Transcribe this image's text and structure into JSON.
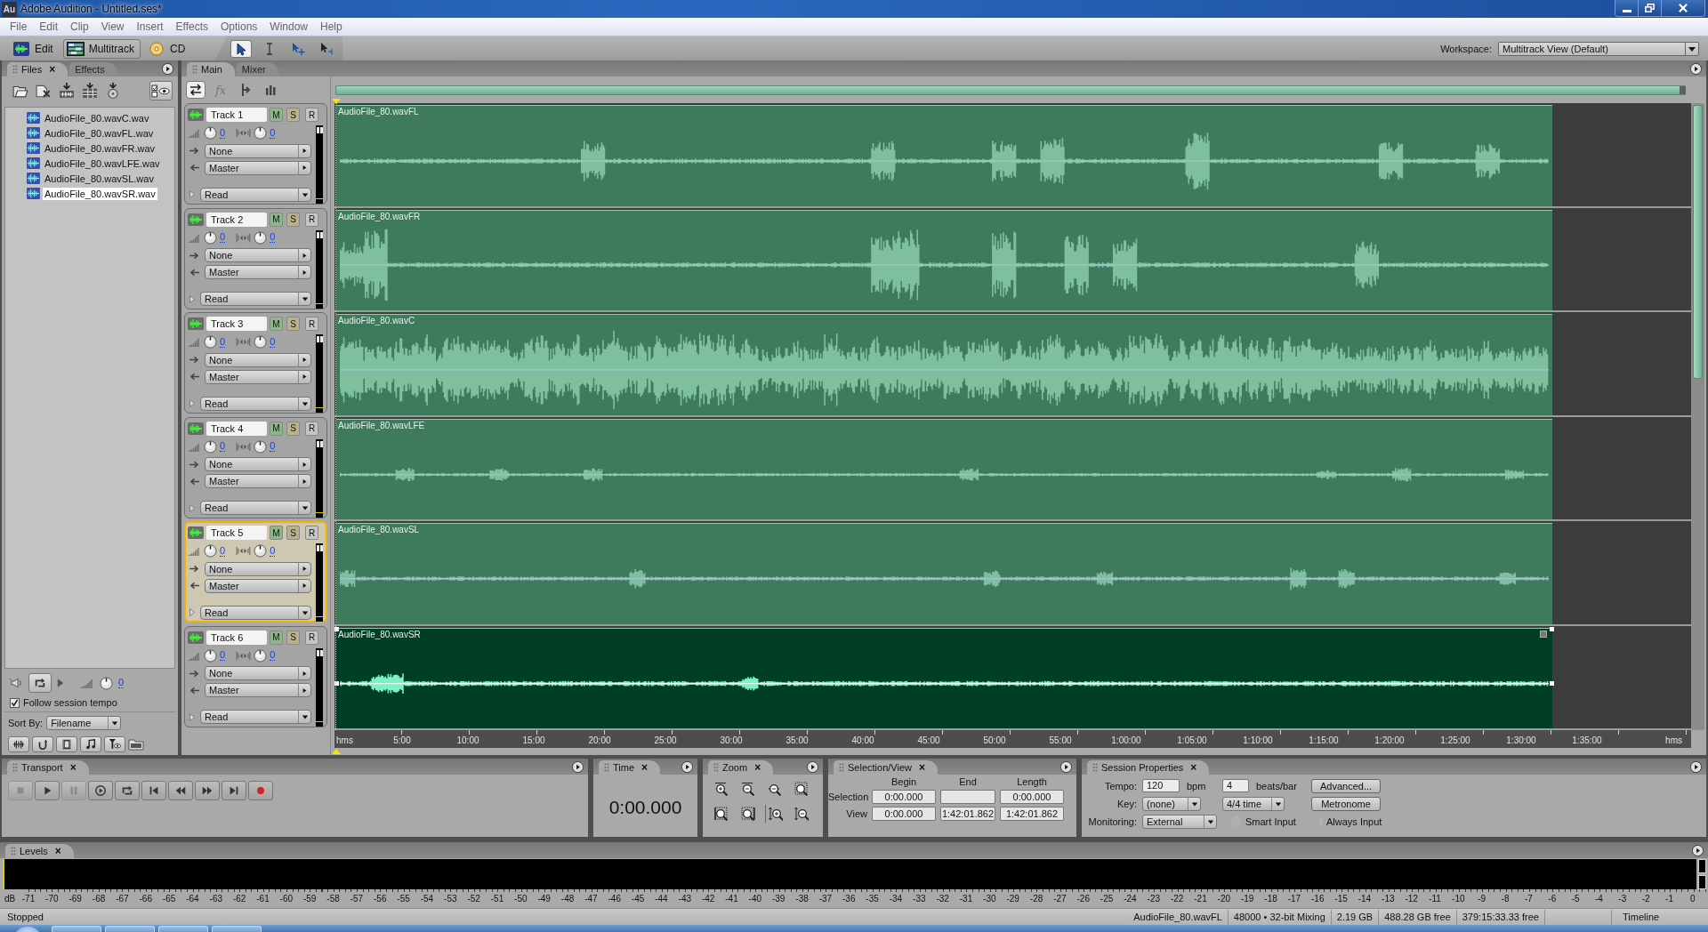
{
  "window": {
    "app_icon": "Au",
    "title": "Adobe Audition - Untitled.ses*"
  },
  "menu": [
    "File",
    "Edit",
    "Clip",
    "View",
    "Insert",
    "Effects",
    "Options",
    "Window",
    "Help"
  ],
  "toolbar": {
    "views": [
      {
        "kind": "edit",
        "label": "Edit",
        "selected": false
      },
      {
        "kind": "multitrack",
        "label": "Multitrack",
        "selected": true
      },
      {
        "kind": "cd",
        "label": "CD",
        "selected": false
      }
    ],
    "tools": [
      {
        "kind": "move",
        "selected": true
      },
      {
        "kind": "time_selection",
        "selected": false
      },
      {
        "kind": "hybrid",
        "selected": false
      },
      {
        "kind": "scrub",
        "selected": false
      }
    ],
    "workspace": {
      "label": "Workspace:",
      "value": "Multitrack View (Default)"
    }
  },
  "files_panel": {
    "tabs": [
      {
        "label": "Files",
        "close": "×",
        "selected": true
      },
      {
        "label": "Effects",
        "selected": false
      }
    ],
    "files": [
      {
        "name": "AudioFile_80.wavC.wav",
        "selected": false
      },
      {
        "name": "AudioFile_80.wavFL.wav",
        "selected": false
      },
      {
        "name": "AudioFile_80.wavFR.wav",
        "selected": false
      },
      {
        "name": "AudioFile_80.wavLFE.wav",
        "selected": false
      },
      {
        "name": "AudioFile_80.wavSL.wav",
        "selected": false
      },
      {
        "name": "AudioFile_80.wavSR.wav",
        "selected": true
      }
    ],
    "preview": {
      "volume": "0"
    },
    "follow_tempo": {
      "label": "Follow session tempo",
      "checked": true
    },
    "sort": {
      "label": "Sort By:",
      "value": "Filename"
    }
  },
  "main_panel": {
    "tabs": [
      {
        "label": "Main",
        "selected": true
      },
      {
        "label": "Mixer",
        "selected": false
      }
    ],
    "view_buttons": [
      {
        "kind": "inputs_outputs",
        "selected": true
      },
      {
        "kind": "effects",
        "label": "fx",
        "selected": false
      },
      {
        "kind": "sends",
        "selected": false
      },
      {
        "kind": "eq",
        "selected": false
      }
    ],
    "tracks": [
      {
        "name": "Track 1",
        "mute": "M",
        "solo": "S",
        "record": "R",
        "volume": "0",
        "pan": "0",
        "send": "None",
        "output": "Master",
        "automation": "Read",
        "selected": false,
        "clip": {
          "label": "AudioFile_80.wavFL",
          "selected": false
        }
      },
      {
        "name": "Track 2",
        "mute": "M",
        "solo": "S",
        "record": "R",
        "volume": "0",
        "pan": "0",
        "send": "None",
        "output": "Master",
        "automation": "Read",
        "selected": false,
        "clip": {
          "label": "AudioFile_80.wavFR",
          "selected": false
        }
      },
      {
        "name": "Track 3",
        "mute": "M",
        "solo": "S",
        "record": "R",
        "volume": "0",
        "pan": "0",
        "send": "None",
        "output": "Master",
        "automation": "Read",
        "selected": false,
        "clip": {
          "label": "AudioFile_80.wavC",
          "selected": false
        }
      },
      {
        "name": "Track 4",
        "mute": "M",
        "solo": "S",
        "record": "R",
        "volume": "0",
        "pan": "0",
        "send": "None",
        "output": "Master",
        "automation": "Read",
        "selected": false,
        "clip": {
          "label": "AudioFile_80.wavLFE",
          "selected": false
        }
      },
      {
        "name": "Track 5",
        "mute": "M",
        "solo": "S",
        "record": "R",
        "volume": "0",
        "pan": "0",
        "send": "None",
        "output": "Master",
        "automation": "Read",
        "selected": true,
        "clip": {
          "label": "AudioFile_80.wavSL",
          "selected": false
        }
      },
      {
        "name": "Track 6",
        "mute": "M",
        "solo": "S",
        "record": "R",
        "volume": "0",
        "pan": "0",
        "send": "None",
        "output": "Master",
        "automation": "Read",
        "selected": false,
        "clip": {
          "label": "AudioFile_80.wavSR",
          "selected": true
        }
      }
    ],
    "ruler": [
      "hms",
      "5:00",
      "10:00",
      "15:00",
      "20:00",
      "25:00",
      "30:00",
      "35:00",
      "40:00",
      "45:00",
      "50:00",
      "55:00",
      "1:00:00",
      "1:05:00",
      "1:10:00",
      "1:15:00",
      "1:20:00",
      "1:25:00",
      "1:30:00",
      "1:35:00"
    ],
    "ruler_end": "hms"
  },
  "transport": {
    "title": "Transport",
    "close": "×",
    "buttons": [
      {
        "kind": "stop",
        "disabled": true
      },
      {
        "kind": "play",
        "disabled": false
      },
      {
        "kind": "pause",
        "disabled": true
      },
      {
        "kind": "play_to_end",
        "disabled": false
      },
      {
        "kind": "loop",
        "disabled": false
      },
      {
        "kind": "go_to_start",
        "disabled": false
      },
      {
        "kind": "rewind",
        "disabled": false
      },
      {
        "kind": "fast_forward",
        "disabled": false
      },
      {
        "kind": "go_to_end",
        "disabled": false
      },
      {
        "kind": "record",
        "disabled": false
      }
    ]
  },
  "time": {
    "title": "Time",
    "close": "×",
    "value": "0:00.000"
  },
  "zoom": {
    "title": "Zoom",
    "close": "×"
  },
  "selection_view": {
    "title": "Selection/View",
    "close": "×",
    "columns": [
      "Begin",
      "End",
      "Length"
    ],
    "rows": [
      {
        "label": "Selection",
        "begin": "0:00.000",
        "length": "0:00.000"
      },
      {
        "label": "View",
        "begin": "0:00.000",
        "end": "1:42:01.862",
        "length": "1:42:01.862"
      }
    ]
  },
  "session_properties": {
    "title": "Session Properties",
    "close": "×",
    "tempo": {
      "label": "Tempo:",
      "value": "120",
      "unit": "bpm"
    },
    "beats": {
      "value": "4",
      "unit": "beats/bar"
    },
    "advanced_button": "Advanced...",
    "key": {
      "label": "Key:",
      "value": "(none)"
    },
    "time_signature": "4/4 time",
    "metronome_button": "Metronome",
    "monitoring": {
      "label": "Monitoring:",
      "value": "External"
    },
    "radios": [
      {
        "label": "Smart Input",
        "selected": false
      },
      {
        "label": "Always Input",
        "selected": false
      }
    ]
  },
  "levels": {
    "title": "Levels",
    "close": "×",
    "scale": [
      "dB",
      "-71",
      "-70",
      "-69",
      "-68",
      "-67",
      "-66",
      "-65",
      "-64",
      "-63",
      "-62",
      "-61",
      "-60",
      "-59",
      "-58",
      "-57",
      "-56",
      "-55",
      "-54",
      "-53",
      "-52",
      "-51",
      "-50",
      "-49",
      "-48",
      "-47",
      "-46",
      "-45",
      "-44",
      "-43",
      "-42",
      "-41",
      "-40",
      "-39",
      "-38",
      "-37",
      "-36",
      "-35",
      "-34",
      "-33",
      "-32",
      "-31",
      "-30",
      "-29",
      "-28",
      "-27",
      "-26",
      "-25",
      "-24",
      "-23",
      "-22",
      "-21",
      "-20",
      "-19",
      "-18",
      "-17",
      "-16",
      "-15",
      "-14",
      "-13",
      "-12",
      "-11",
      "-10",
      "-9",
      "-8",
      "-7",
      "-6",
      "-5",
      "-4",
      "-3",
      "-2",
      "-1",
      "0"
    ]
  },
  "status_bar": {
    "state": "Stopped",
    "fields": [
      "AudioFile_80.wavFL",
      "48000 • 32-bit Mixing",
      "2.19 GB",
      "488.28 GB free",
      "379:15:33.33 free"
    ],
    "view_mode": "Timeline"
  }
}
